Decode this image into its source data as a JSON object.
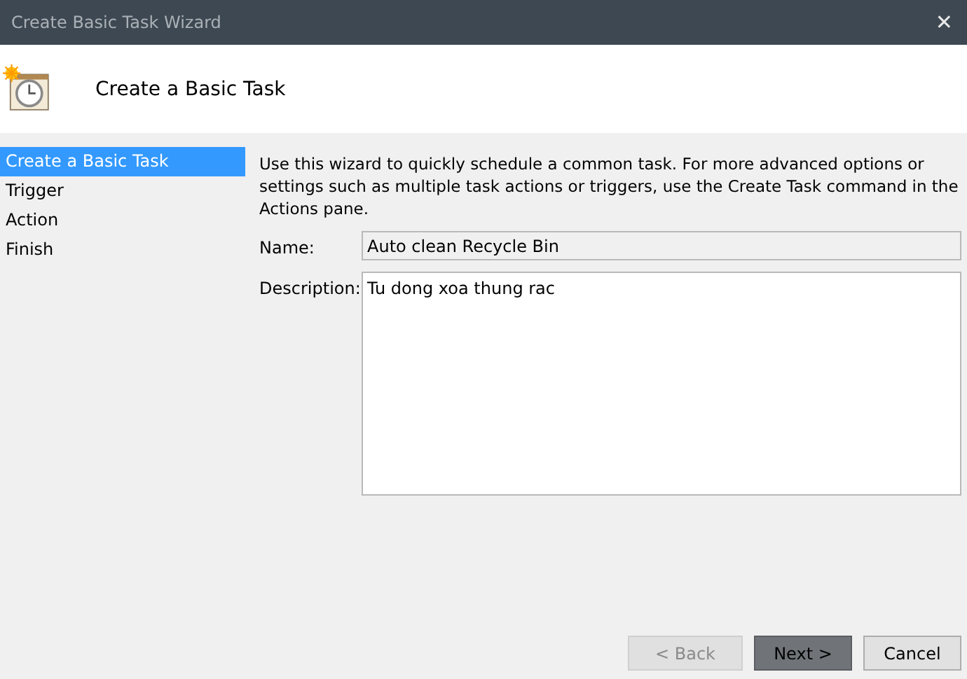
{
  "window": {
    "title": "Create Basic Task Wizard",
    "close": "✕"
  },
  "header": {
    "title": "Create a Basic Task"
  },
  "sidebar": {
    "items": [
      {
        "label": "Create a Basic Task",
        "selected": true
      },
      {
        "label": "Trigger",
        "selected": false
      },
      {
        "label": "Action",
        "selected": false
      },
      {
        "label": "Finish",
        "selected": false
      }
    ]
  },
  "intro": "Use this wizard to quickly schedule a common task.  For more advanced options or settings such as multiple task actions or triggers, use the Create Task command in the Actions pane.",
  "fields": [
    {
      "kind": "line",
      "label": "Name:",
      "value": "Auto clean Recycle Bin"
    },
    {
      "kind": "area",
      "label": "Description:",
      "value": "Tu dong xoa thung rac"
    }
  ],
  "buttons": [
    {
      "label": "< Back",
      "disabled": true,
      "default": false
    },
    {
      "label": "Next >",
      "disabled": false,
      "default": true
    },
    {
      "label": "Cancel",
      "disabled": false,
      "default": false
    }
  ]
}
